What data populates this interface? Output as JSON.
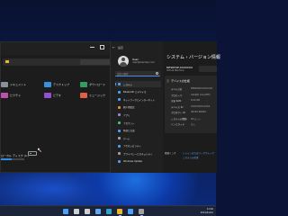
{
  "explorer": {
    "folders": [
      {
        "label": "デスクトップ",
        "color": "#3a8fe0"
      },
      {
        "label": "ダウンロード",
        "color": "#2f9e62"
      },
      {
        "label": "ドキュメント",
        "color": "#8a8f9a"
      },
      {
        "label": "ピクチャ",
        "color": "#c050b0"
      },
      {
        "label": "ビデオ",
        "color": "#9050d0"
      },
      {
        "label": "ミュージック",
        "color": "#e06040"
      }
    ],
    "drive_label": "ローカル ディスク (C:)",
    "drive_usage": 0.45
  },
  "settings": {
    "window_title": "設定",
    "user": {
      "name": "User",
      "email": "user@example.com"
    },
    "search_placeholder": "設定の検索",
    "nav": [
      {
        "label": "システム",
        "color": "#4ca0f5",
        "active": true
      },
      {
        "label": "Bluetooth とデバイス",
        "color": "#4ca0f5"
      },
      {
        "label": "ネットワークとインターネット",
        "color": "#4ca0f5"
      },
      {
        "label": "個人用設定",
        "color": "#e08a3a"
      },
      {
        "label": "アプリ",
        "color": "#8a8fd0"
      },
      {
        "label": "アカウント",
        "color": "#40c080"
      },
      {
        "label": "時刻と言語",
        "color": "#4ca0f5"
      },
      {
        "label": "ゲーム",
        "color": "#a0a0a0"
      },
      {
        "label": "アクセシビリティ",
        "color": "#4ca0f5"
      },
      {
        "label": "プライバシーとセキュリティ",
        "color": "#a0a0a0"
      },
      {
        "label": "Windows Update",
        "color": "#4ca0f5"
      }
    ],
    "page_title": "システム › バージョン情報",
    "device_name": "DESKTOP-XXXXXXX",
    "device_model": "Virtual Machine",
    "rename_label": "この PC の名前を変更",
    "card_title": "デバイスの仕様",
    "specs": [
      {
        "k": "デバイス名",
        "v": "DESKTOP-XXXXXXX"
      },
      {
        "k": "プロセッサ",
        "v": "Intel(R) Core(TM)"
      },
      {
        "k": "実装 RAM",
        "v": "8.00 GB"
      },
      {
        "k": "デバイス ID",
        "v": "XXXXXXXX-XXXX"
      },
      {
        "k": "プロダクト ID",
        "v": "00330-80000"
      },
      {
        "k": "システムの種類",
        "v": "64 ビット"
      },
      {
        "k": "ペンとタッチ",
        "v": "なし"
      }
    ],
    "related_label": "関連リンク",
    "related_link": "ドメインまたはワークグループ",
    "related_link2": "システムの保護"
  },
  "taskbar": {
    "apps": [
      {
        "name": "start",
        "color": "#4ca0f5"
      },
      {
        "name": "search",
        "color": "#d0d0d0"
      },
      {
        "name": "taskview",
        "color": "#d0d0d0"
      },
      {
        "name": "widgets",
        "color": "#60a8f0"
      },
      {
        "name": "edge",
        "color": "#2fa3c8"
      },
      {
        "name": "explorer",
        "color": "#e8b632"
      },
      {
        "name": "store",
        "color": "#4ca0f5"
      },
      {
        "name": "settings",
        "color": "#a0a0a0"
      }
    ],
    "time": "12:00",
    "date": "2024/01/01"
  }
}
